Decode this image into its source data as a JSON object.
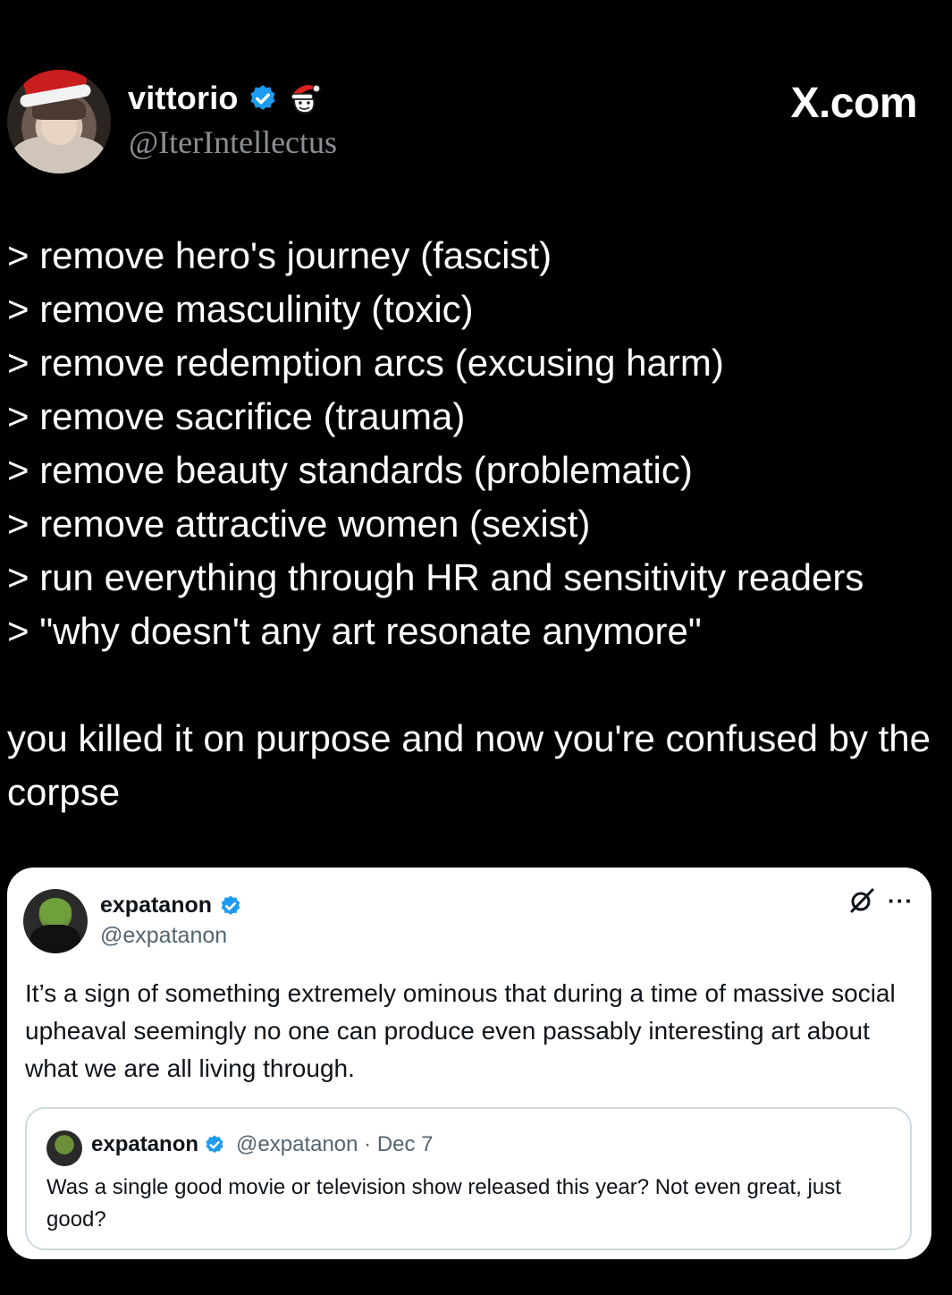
{
  "post": {
    "author": {
      "display_name": "vittorio",
      "handle": "@IterIntellectus"
    },
    "brand": "X.com",
    "lines": [
      "> remove hero's journey (fascist)",
      "> remove masculinity (toxic)",
      "> remove redemption arcs (excusing harm)",
      "> remove sacrifice (trauma)",
      "> remove beauty standards (problematic)",
      "> remove attractive women (sexist)",
      "> run everything through HR and sensitivity readers",
      "> \"why doesn't any art resonate anymore\""
    ],
    "closing": "you killed it on purpose and now you're confused by the corpse"
  },
  "quoted": {
    "display_name": "expatanon",
    "handle": "@expatanon",
    "more_label": "···",
    "text": "It’s a sign of something extremely ominous that during a time of massive social upheaval seemingly no one can produce even passably interesting art about what we are all living through.",
    "inner": {
      "display_name": "expatanon",
      "meta": "@expatanon · Dec 7",
      "text": "Was a single good movie or television show released this year? Not even great, just good?"
    }
  },
  "colors": {
    "background": "#000000",
    "verified_blue": "#1d9bf0",
    "handle_gray": "#8b8f94",
    "card_background": "#ffffff"
  },
  "icons": [
    "verified-badge-icon",
    "santa-emoji-badge-icon",
    "grok-slash-icon",
    "more-options-icon"
  ]
}
